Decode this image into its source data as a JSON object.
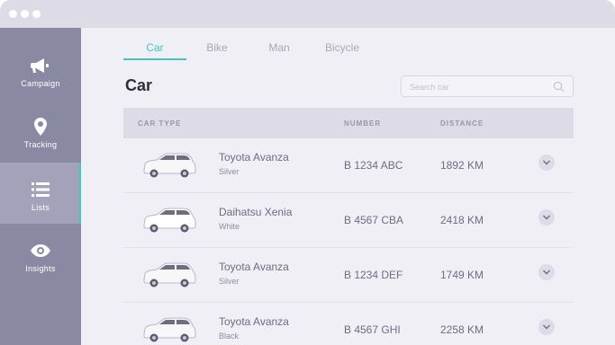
{
  "window": {
    "controls": [
      "close",
      "minimize",
      "maximize"
    ]
  },
  "sidebar": {
    "items": [
      {
        "label": "Campaign",
        "icon": "megaphone-icon",
        "active": false
      },
      {
        "label": "Tracking",
        "icon": "location-pin-icon",
        "active": false
      },
      {
        "label": "Lists",
        "icon": "list-icon",
        "active": true
      },
      {
        "label": "Insights",
        "icon": "eye-icon",
        "active": false
      }
    ]
  },
  "tabs": [
    {
      "label": "Car",
      "active": true
    },
    {
      "label": "Bike",
      "active": false
    },
    {
      "label": "Man",
      "active": false
    },
    {
      "label": "Bicycle",
      "active": false
    }
  ],
  "page": {
    "title": "Car"
  },
  "search": {
    "placeholder": "Search car",
    "value": ""
  },
  "table": {
    "headers": {
      "car_type": "CAR TYPE",
      "number": "NUMBER",
      "distance": "DISTANCE"
    },
    "rows": [
      {
        "name": "Toyota Avanza",
        "color": "Silver",
        "number": "B 1234 ABC",
        "distance": "1892 KM"
      },
      {
        "name": "Daihatsu Xenia",
        "color": "White",
        "number": "B 4567 CBA",
        "distance": "2418 KM"
      },
      {
        "name": "Toyota Avanza",
        "color": "Silver",
        "number": "B 1234 DEF",
        "distance": "1749 KM"
      },
      {
        "name": "Toyota Avanza",
        "color": "Black",
        "number": "B 4567 GHI",
        "distance": "2258 KM"
      }
    ]
  },
  "colors": {
    "accent": "#3ec6c1",
    "sidebar": "#8a89a4",
    "sidebar_active": "#a3a2ba",
    "background": "#f0eff5",
    "header": "#dcdbe6"
  }
}
